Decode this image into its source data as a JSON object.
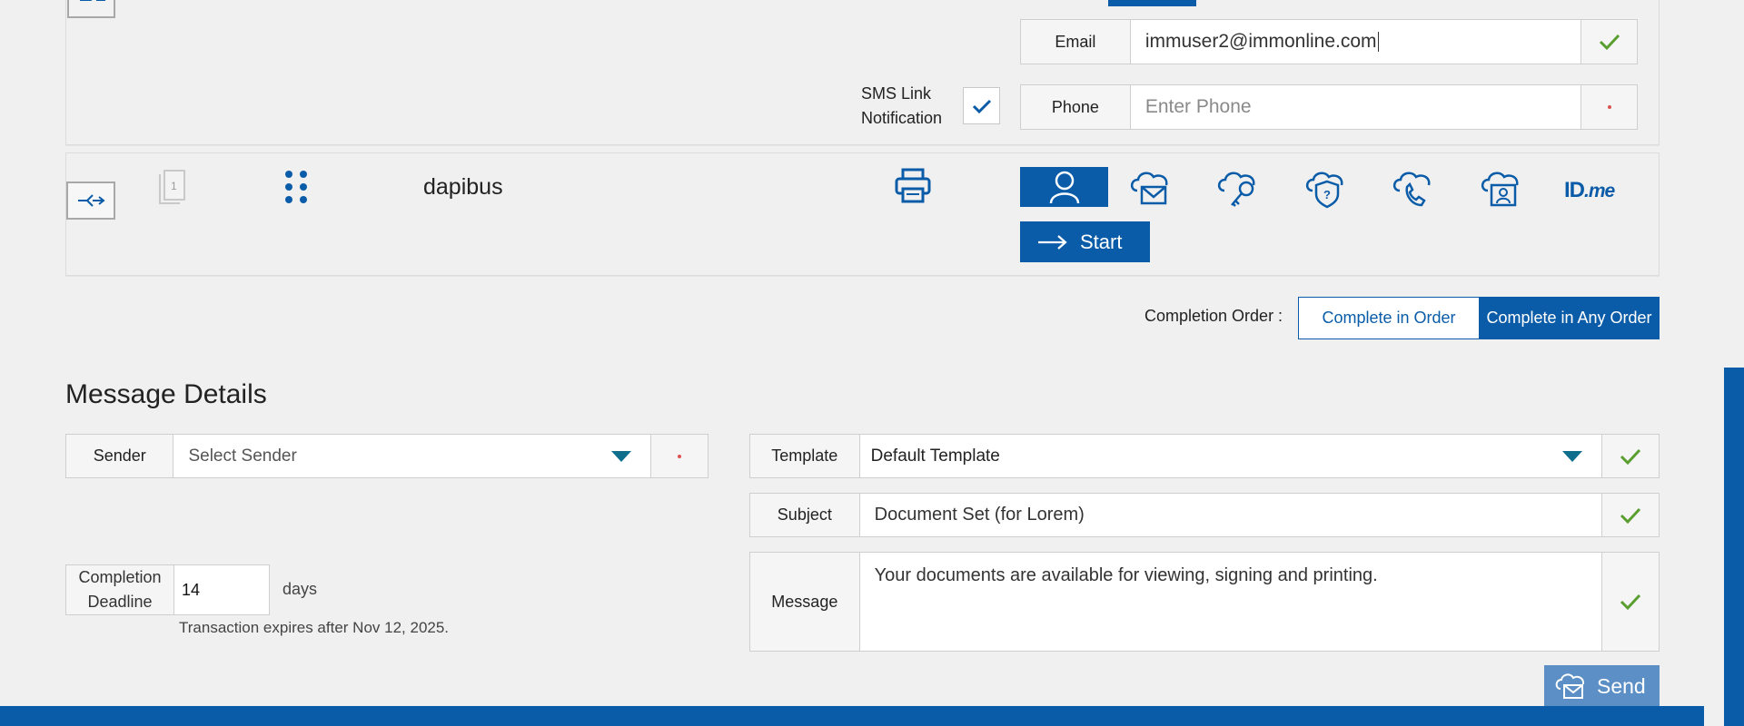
{
  "signer1": {
    "email_label": "Email",
    "email_value": "immuser2@immonline.com",
    "sms_label_line1": "SMS Link",
    "sms_label_line2": "Notification",
    "phone_label": "Phone",
    "phone_placeholder": "Enter Phone"
  },
  "signer2": {
    "order_number": "1",
    "name": "dapibus",
    "idme_label": "ID",
    "idme_suffix": ".me",
    "start_label": "Start"
  },
  "completion_order": {
    "label": "Completion Order :",
    "option_in_order": "Complete in Order",
    "option_any_order": "Complete in Any Order",
    "selected": "Complete in Any Order"
  },
  "message_details": {
    "heading": "Message Details",
    "sender_label": "Sender",
    "sender_placeholder": "Select Sender",
    "template_label": "Template",
    "template_value": "Default Template",
    "subject_label": "Subject",
    "subject_value": "Document Set (for Lorem)",
    "message_label": "Message",
    "message_value": "Your documents are available for viewing, signing and printing.",
    "deadline_label_line1": "Completion",
    "deadline_label_line2": "Deadline",
    "deadline_value": "14",
    "deadline_unit": "days",
    "expiry_note": "Transaction expires after Nov 12, 2025.",
    "send_label": "Send"
  },
  "colors": {
    "accent": "#0b5ca8",
    "check_green": "#5a9e2f",
    "required_red": "#d9534f",
    "send_button": "#5b8fc6"
  }
}
